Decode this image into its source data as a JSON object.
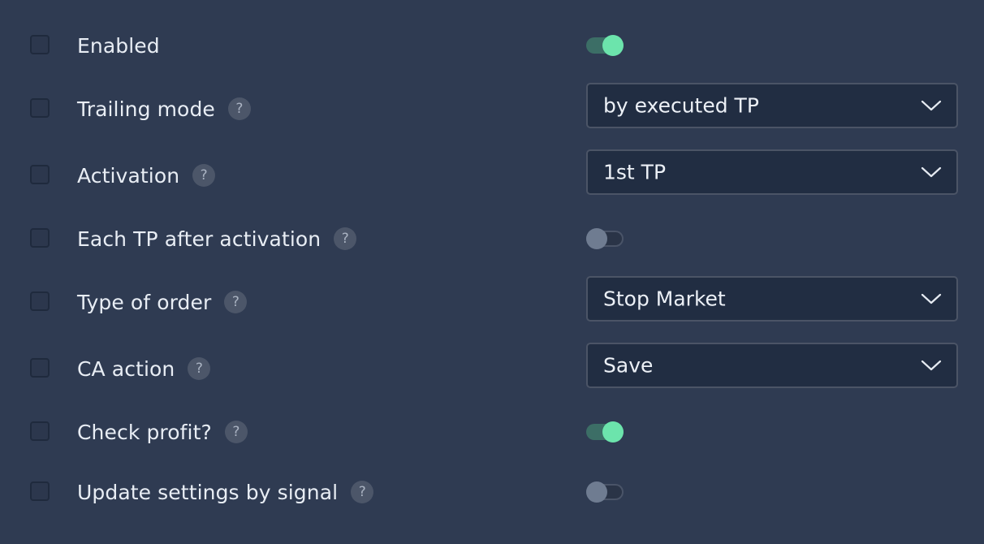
{
  "settings": {
    "enabled": {
      "label": "Enabled",
      "control": "toggle",
      "toggle_on": true
    },
    "trailing_mode": {
      "label": "Trailing mode",
      "help": "?",
      "control": "select",
      "value": "by executed TP"
    },
    "activation": {
      "label": "Activation",
      "help": "?",
      "control": "select",
      "value": "1st TP"
    },
    "each_tp": {
      "label": "Each TP after activation",
      "help": "?",
      "control": "toggle",
      "toggle_on": false
    },
    "order_type": {
      "label": "Type of order",
      "help": "?",
      "control": "select",
      "value": "Stop Market"
    },
    "ca_action": {
      "label": "CA action",
      "help": "?",
      "control": "select",
      "value": "Save"
    },
    "check_profit": {
      "label": "Check profit?",
      "help": "?",
      "control": "toggle",
      "toggle_on": true
    },
    "update_by_signal": {
      "label": "Update settings by signal",
      "help": "?",
      "control": "toggle",
      "toggle_on": false
    }
  },
  "icons": {
    "help": "question-mark-icon",
    "dropdown": "chevron-down-icon"
  },
  "colors": {
    "background": "#2f3b52",
    "toggle_on_knob": "#6ce4ac",
    "toggle_off_knob": "#6f7c91",
    "select_background": "#212d42"
  }
}
